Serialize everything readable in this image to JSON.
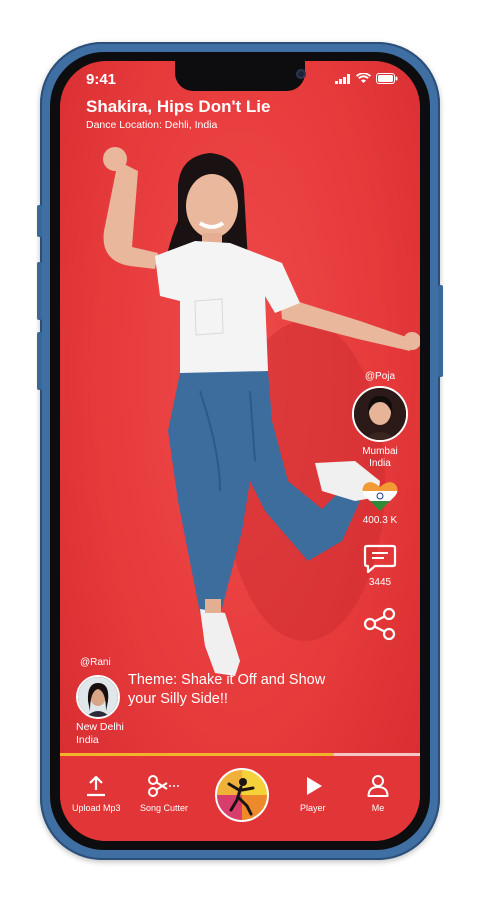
{
  "status": {
    "time": "9:41"
  },
  "header": {
    "song_title": "Shakira, Hips Don't Lie",
    "location": "Dance Location: Dehli, India"
  },
  "creator": {
    "handle": "@Poja",
    "city": "Mumbai",
    "country": "India"
  },
  "stats": {
    "likes": "400.3 K",
    "comments": "3445"
  },
  "theme": {
    "handle": "@Rani",
    "text": "Theme: Shake it Off and Show your Silly Side!!",
    "city": "New Delhi",
    "country": "India"
  },
  "progress": {
    "value": 0.76
  },
  "nav": {
    "upload_label": "Upload Mp3",
    "cutter_label": "Song Cutter",
    "player_label": "Player",
    "me_label": "Me"
  },
  "colors": {
    "background": "#e63a3b",
    "accent": "#f2b52a",
    "frame": "#3f6fa3"
  }
}
